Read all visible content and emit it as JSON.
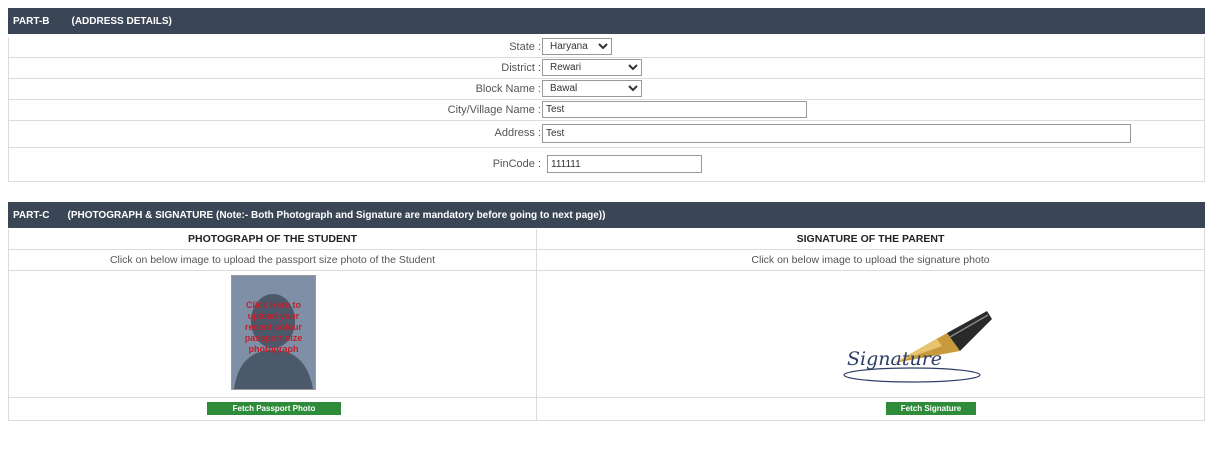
{
  "partb": {
    "part": "PART-B",
    "title": "(ADDRESS DETAILS)",
    "fields": {
      "state": {
        "label": "State :",
        "value": "Haryana"
      },
      "district": {
        "label": "District :",
        "value": "Rewari"
      },
      "block": {
        "label": "Block Name :",
        "value": "Bawal"
      },
      "city": {
        "label": "City/Village Name :",
        "value": "Test"
      },
      "address": {
        "label": "Address :",
        "value": "Test"
      },
      "pincode": {
        "label": "PinCode :",
        "value": "111111"
      }
    }
  },
  "partc": {
    "part": "PART-C",
    "title": "(PHOTOGRAPH & SIGNATURE (Note:- Both Photograph and Signature are mandatory before going to next page))",
    "photo": {
      "header": "PHOTOGRAPH OF THE STUDENT",
      "instruction": "Click on below image to upload the passport size photo of the Student",
      "overlay": "Click Here to upload your recent colour passport size photograph",
      "button": "Fetch Passport Photo"
    },
    "signature": {
      "header": "SIGNATURE OF THE PARENT",
      "instruction": "Click on below image to upload the signature photo",
      "image_text": "Signature",
      "button": "Fetch Signature"
    }
  },
  "colors": {
    "header_bg": "#3a4656",
    "button_bg": "#2e8b3a"
  }
}
